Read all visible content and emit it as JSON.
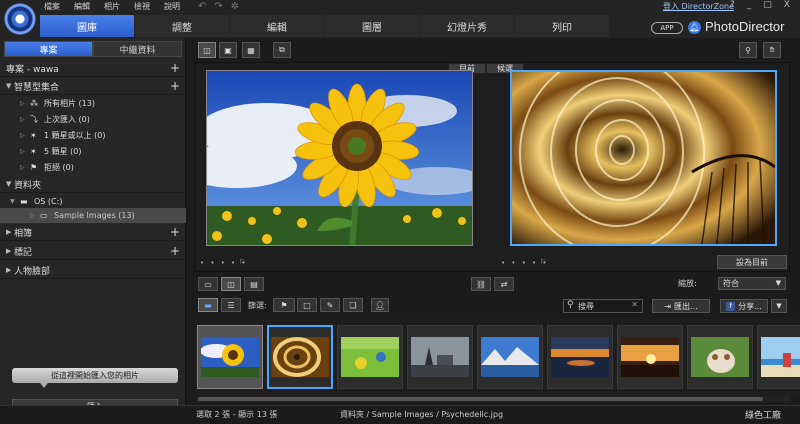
{
  "menu": [
    "檔案",
    "編輯",
    "相片",
    "檢視",
    "說明"
  ],
  "main_tabs": [
    {
      "label": "圖庫",
      "active": true
    },
    {
      "label": "調整",
      "active": false
    },
    {
      "label": "編輯",
      "active": false
    },
    {
      "label": "圖層",
      "active": false
    },
    {
      "label": "幻燈片秀",
      "active": false
    },
    {
      "label": "列印",
      "active": false
    }
  ],
  "header": {
    "login_link": "登入 DirectorZone",
    "help": "?",
    "minimize": "_",
    "maximize": "□",
    "close": "X",
    "app_badge": "APP",
    "brand": "PhotoDirector"
  },
  "left_tabs": [
    "專案",
    "中繼資料"
  ],
  "project": {
    "label": "專案 - wawa"
  },
  "smart_collections": {
    "title": "智慧型集合",
    "items": [
      {
        "label": "所有相片 (13)"
      },
      {
        "label": "上次匯入 (0)"
      },
      {
        "label": "1 顆星或以上 (0)"
      },
      {
        "label": "5 顆星 (0)"
      },
      {
        "label": "拒絕 (0)"
      }
    ]
  },
  "folders": {
    "title": "資料夾",
    "drive": "OS (C:)",
    "subfolder": "Sample Images (13)"
  },
  "albums": "相簿",
  "tags": "標記",
  "faces": "人物臉部",
  "hint": "從這裡開始匯入您的相片",
  "import_button": "匯入",
  "compare": {
    "current": "目前",
    "candidate": "候選"
  },
  "set_current_button": "設為目前",
  "dots": "• • • • •",
  "zoom": {
    "label": "縮放:",
    "value": "符合"
  },
  "filter_label": "篩選:",
  "search_placeholder": "搜尋",
  "export_button": "匯出...",
  "share_button": "分享...",
  "status": "選取 2 張 - 顯示 13 張",
  "path": "資料夾 / Sample Images / Psychedelic.jpg",
  "watermark": "綠色工廠",
  "colors": {
    "accent": "#3a6fd6",
    "selection_blue": "#4aa8ff"
  }
}
